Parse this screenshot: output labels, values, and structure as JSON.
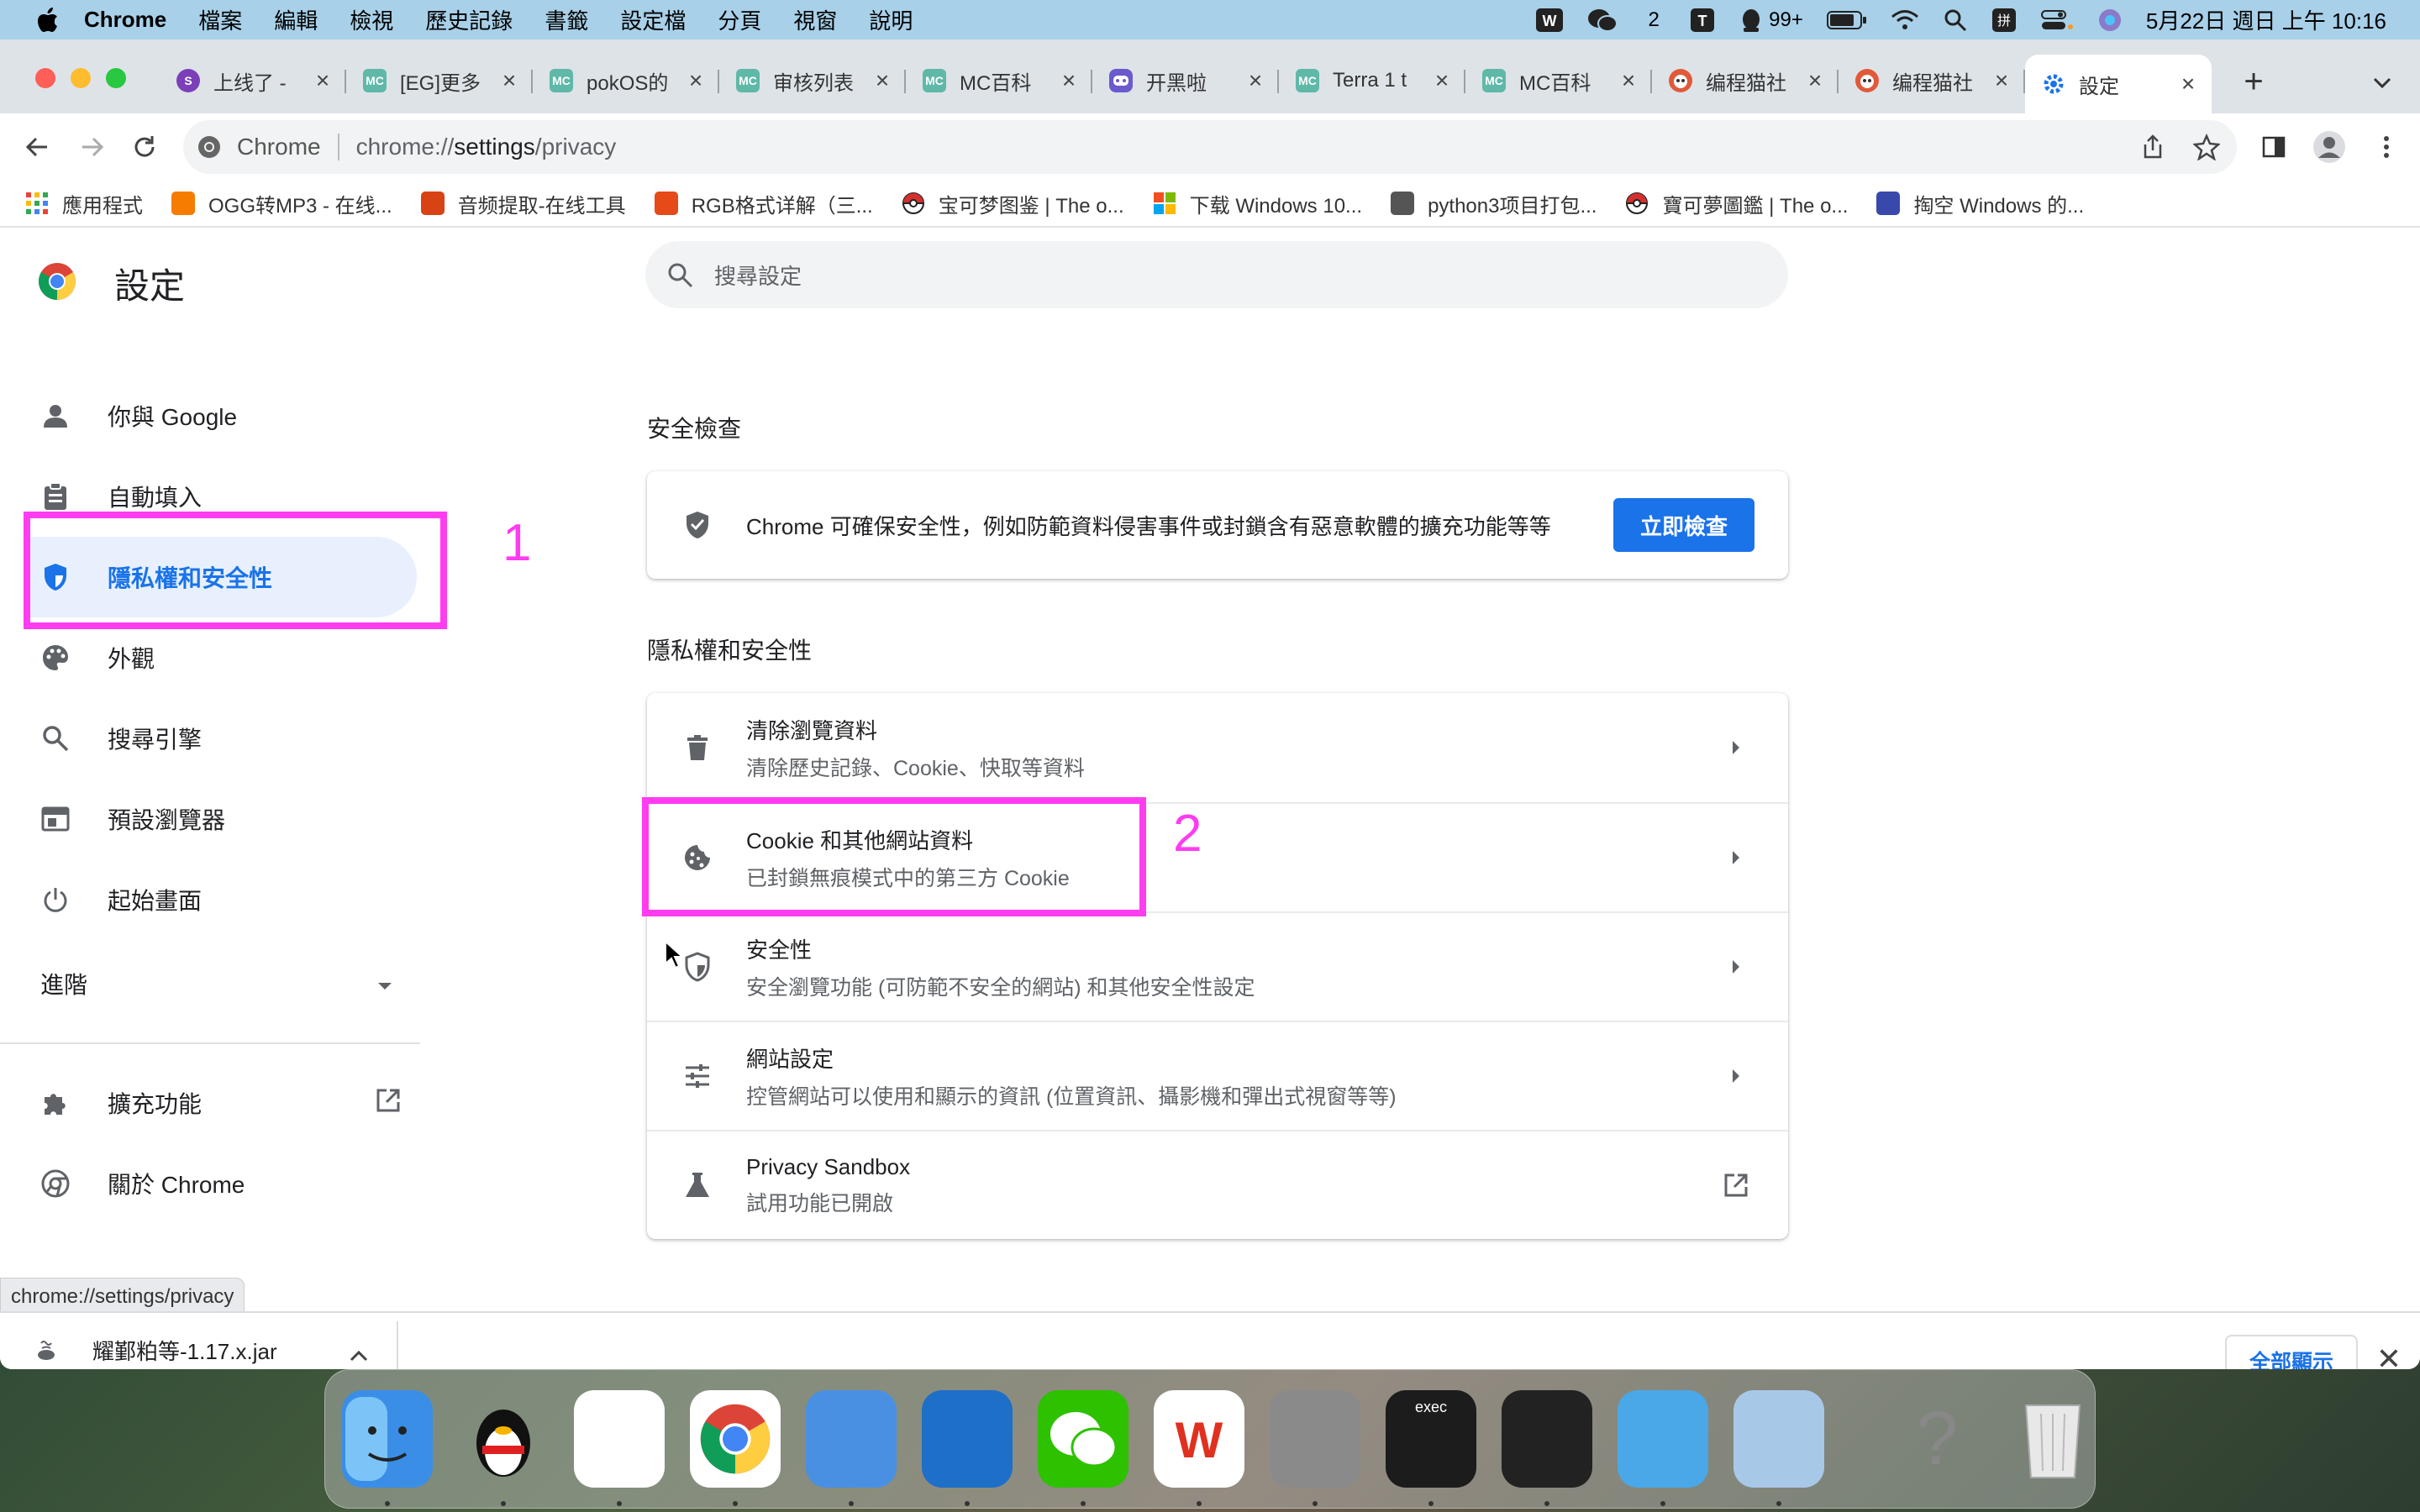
{
  "menubar": {
    "app_name": "Chrome",
    "items": [
      "檔案",
      "編輯",
      "檢視",
      "歷史記錄",
      "書籤",
      "設定檔",
      "分頁",
      "視窗",
      "說明"
    ],
    "wechat_count": "2",
    "qq_count": "99+",
    "datetime": "5月22日 週日 上午 10:16"
  },
  "tabs": [
    {
      "label": "上线了 -",
      "icon": "s-logo",
      "color": "#7b3fb8"
    },
    {
      "label": "[EG]更多",
      "icon": "mc-logo",
      "color": "#5fb8a8"
    },
    {
      "label": "pokOS的",
      "icon": "mc-logo",
      "color": "#5fb8a8"
    },
    {
      "label": "审核列表",
      "icon": "mc-logo",
      "color": "#5fb8a8"
    },
    {
      "label": "MC百科",
      "icon": "mc-logo",
      "color": "#5fb8a8"
    },
    {
      "label": "开黑啦",
      "icon": "kook-logo",
      "color": "#6a5acd"
    },
    {
      "label": "Terra 1 t",
      "icon": "mc-logo",
      "color": "#5fb8a8"
    },
    {
      "label": "MC百科",
      "icon": "mc-logo",
      "color": "#5fb8a8"
    },
    {
      "label": "编程猫社",
      "icon": "codemao-logo",
      "color": "#e05a3a"
    },
    {
      "label": "编程猫社",
      "icon": "codemao-logo",
      "color": "#e05a3a"
    },
    {
      "label": "設定",
      "icon": "gear-icon",
      "color": "#1a73e8",
      "active": true
    }
  ],
  "omnibox": {
    "chip": "Chrome",
    "url_prefix": "chrome://",
    "url_host": "settings",
    "url_path": "/privacy"
  },
  "bookmarks": [
    {
      "label": "應用程式",
      "icon": "apps-grid-icon",
      "color": "#ea4335"
    },
    {
      "label": "OGG转MP3 - 在线...",
      "icon": "convert-icon",
      "color": "#f57c00"
    },
    {
      "label": "音频提取-在线工具",
      "icon": "audio-icon",
      "color": "#d84315"
    },
    {
      "label": "RGB格式详解（三...",
      "icon": "c-icon",
      "color": "#e64a19"
    },
    {
      "label": "宝可梦图鉴 | The o...",
      "icon": "pokeball-icon",
      "color": "#d32f2f"
    },
    {
      "label": "下载 Windows 10...",
      "icon": "windows-icon",
      "color": "#0078d4"
    },
    {
      "label": "python3项目打包...",
      "icon": "bird-icon",
      "color": "#555555"
    },
    {
      "label": "寶可夢圖鑑 | The o...",
      "icon": "pokeball-icon",
      "color": "#d32f2f"
    },
    {
      "label": "掏空 Windows 的...",
      "icon": "paw-icon",
      "color": "#3949ab"
    }
  ],
  "settings": {
    "title": "設定",
    "search_placeholder": "搜尋設定",
    "nav": [
      {
        "label": "你與 Google",
        "icon": "person-icon"
      },
      {
        "label": "自動填入",
        "icon": "clipboard-icon"
      },
      {
        "label": "隱私權和安全性",
        "icon": "shield-icon",
        "active": true
      },
      {
        "label": "外觀",
        "icon": "palette-icon"
      },
      {
        "label": "搜尋引擎",
        "icon": "search-icon"
      },
      {
        "label": "預設瀏覽器",
        "icon": "browser-icon"
      },
      {
        "label": "起始畫面",
        "icon": "power-icon"
      }
    ],
    "advanced_label": "進階",
    "nav_bottom": [
      {
        "label": "擴充功能",
        "icon": "puzzle-icon"
      },
      {
        "label": "關於 Chrome",
        "icon": "chrome-icon"
      }
    ],
    "safety_check": {
      "section_title": "安全檢查",
      "text": "Chrome 可確保安全性，例如防範資料侵害事件或封鎖含有惡意軟體的擴充功能等等",
      "button_label": "立即檢查"
    },
    "privacy": {
      "section_title": "隱私權和安全性",
      "rows": [
        {
          "title": "清除瀏覽資料",
          "subtitle": "清除歷史記錄、Cookie、快取等資料",
          "icon": "trash-icon"
        },
        {
          "title": "Cookie 和其他網站資料",
          "subtitle": "已封鎖無痕模式中的第三方 Cookie",
          "icon": "cookie-icon"
        },
        {
          "title": "安全性",
          "subtitle": "安全瀏覽功能 (可防範不安全的網站) 和其他安全性設定",
          "icon": "shield-outline-icon"
        },
        {
          "title": "網站設定",
          "subtitle": "控管網站可以使用和顯示的資訊 (位置資訊、攝影機和彈出式視窗等等)",
          "icon": "tune-icon"
        },
        {
          "title": "Privacy Sandbox",
          "subtitle": "試用功能已開啟",
          "icon": "flask-icon"
        }
      ]
    }
  },
  "annotations": {
    "first": "1",
    "second": "2",
    "color": "#ff3cf0"
  },
  "status_bar_url": "chrome://settings/privacy",
  "download": {
    "filename": "耀鄞粕等-1.17.x.jar",
    "show_all": "全部顯示"
  },
  "dock": [
    {
      "name": "finder",
      "color": "#3a8ee6"
    },
    {
      "name": "qq",
      "color": "#f0f0f0"
    },
    {
      "name": "java",
      "color": "#ffffff"
    },
    {
      "name": "chrome",
      "color": "#ffffff"
    },
    {
      "name": "codemao",
      "color": "#4a90e2"
    },
    {
      "name": "app-blue",
      "color": "#1e6fc8"
    },
    {
      "name": "wechat",
      "color": "#2dc100"
    },
    {
      "name": "wps",
      "color": "#ffffff"
    },
    {
      "name": "system-preferences",
      "color": "#8a8a8a"
    },
    {
      "name": "terminal",
      "color": "#1c1c1c",
      "label": "exec"
    },
    {
      "name": "mcreator",
      "color": "#222222"
    },
    {
      "name": "codemao-2",
      "color": "#4aa8e8"
    },
    {
      "name": "preview",
      "color": "#a8c8e8"
    },
    {
      "name": "unknown",
      "color": "#bbbbbb",
      "label": "?"
    },
    {
      "name": "trash",
      "color": "#d8d8d8"
    }
  ]
}
